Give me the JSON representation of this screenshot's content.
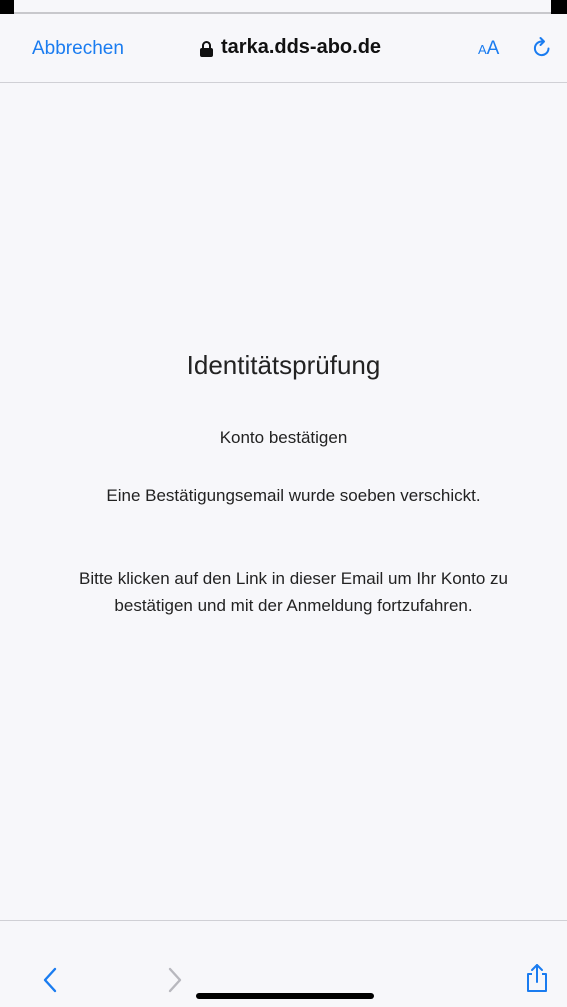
{
  "header": {
    "cancel_label": "Abbrechen",
    "url": "tarka.dds-abo.de",
    "text_size_small": "A",
    "text_size_big": "A"
  },
  "content": {
    "title": "Identitätsprüfung",
    "subtitle": "Konto bestätigen",
    "message_1": "Eine Bestätigungsemail wurde soeben verschickt.",
    "message_2": "Bitte klicken auf den Link in dieser Email um Ihr Konto zu bestätigen und mit der Anmeldung fortzufahren."
  },
  "toolbar": {
    "icons": [
      "back-icon",
      "forward-icon",
      "share-icon"
    ]
  },
  "colors": {
    "accent": "#1a7cf0",
    "background": "#f7f7fa",
    "text": "#222222",
    "disabled": "#b8b8be"
  }
}
